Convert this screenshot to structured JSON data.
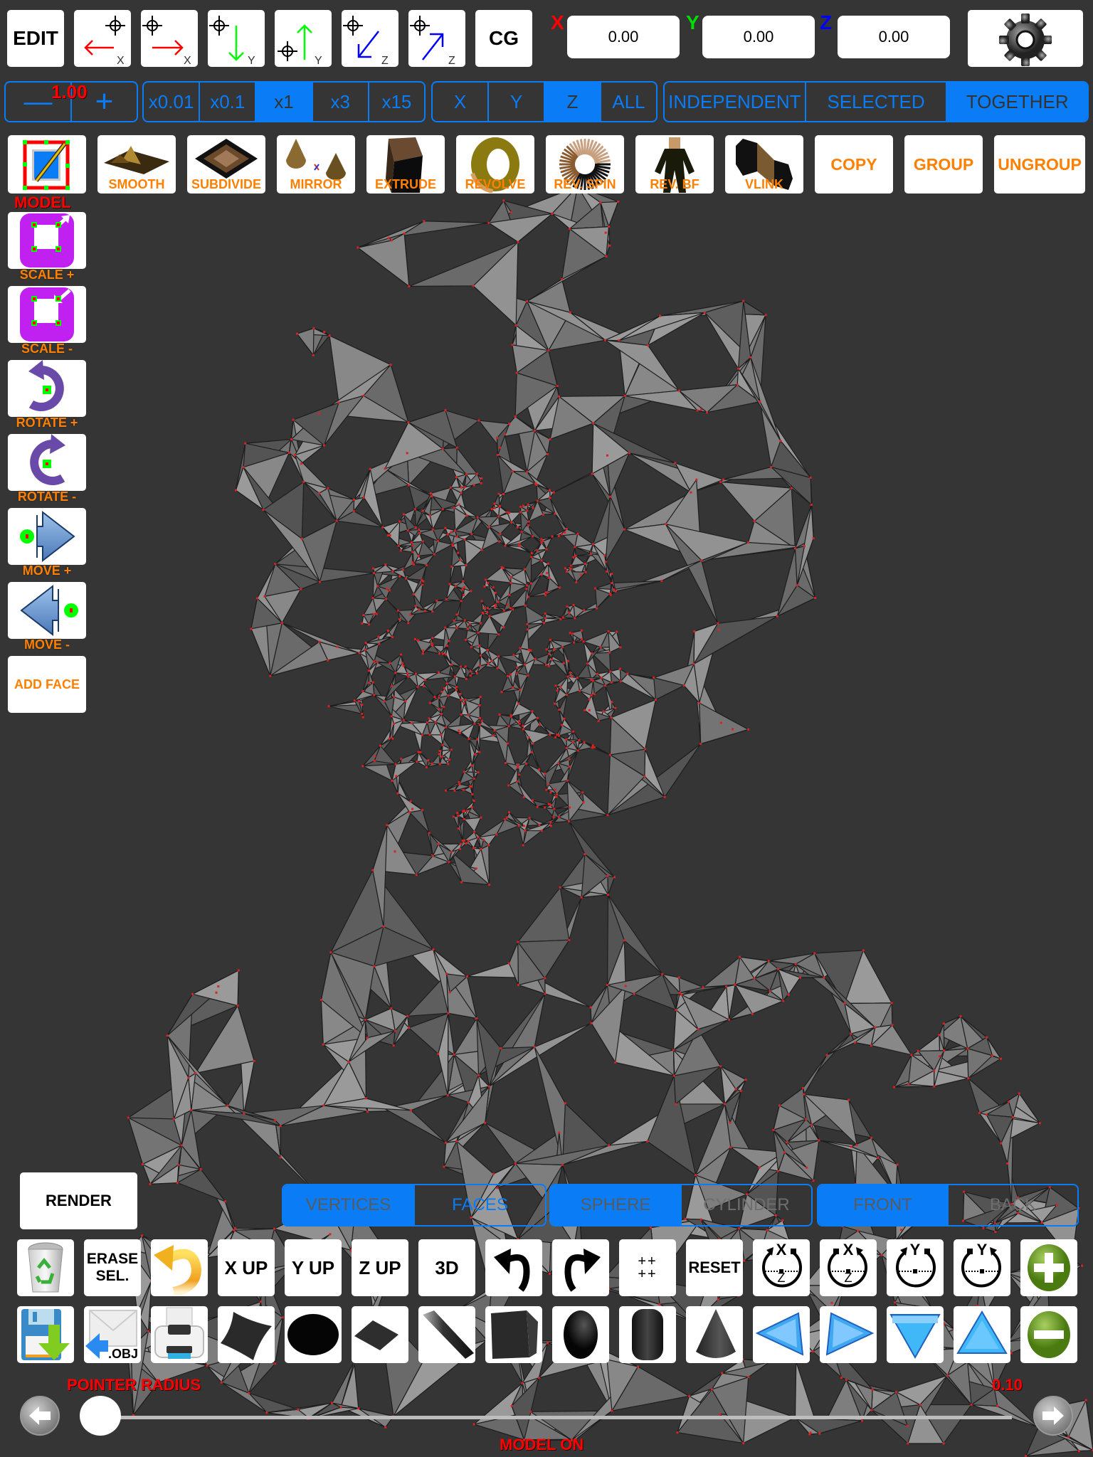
{
  "top_toolbar": {
    "edit_label": "EDIT",
    "move_buttons": [
      {
        "name": "move-left-x",
        "axis": "X",
        "dir": "left",
        "color": "#ff0000"
      },
      {
        "name": "move-right-x",
        "axis": "X",
        "dir": "right",
        "color": "#ff0000"
      },
      {
        "name": "move-down-y",
        "axis": "Y",
        "dir": "down",
        "color": "#00ff00"
      },
      {
        "name": "move-up-y",
        "axis": "Y",
        "dir": "up",
        "color": "#00ff00"
      },
      {
        "name": "move-in-z",
        "axis": "Z",
        "dir": "downleft",
        "color": "#0000ff"
      },
      {
        "name": "move-out-z",
        "axis": "Z",
        "dir": "upright",
        "color": "#0000ff"
      }
    ],
    "cg_label": "CG",
    "coords": [
      {
        "label": "X",
        "value": "0.00",
        "color": "#ff0000"
      },
      {
        "label": "Y",
        "value": "0.00",
        "color": "#00dd00"
      },
      {
        "label": "Z",
        "value": "0.00",
        "color": "#0000ff"
      }
    ],
    "settings_icon": "gear-icon"
  },
  "step_control": {
    "minus": "—",
    "plus": "+",
    "value": "1.00"
  },
  "multiplier": {
    "options": [
      "x0.01",
      "x0.1",
      "x1",
      "x3",
      "x15"
    ],
    "selected": "x1"
  },
  "axis_select": {
    "options": [
      "X",
      "Y",
      "Z",
      "ALL"
    ],
    "selected": "Z"
  },
  "mode_select": {
    "options": [
      "INDEPENDENT",
      "SELECTED",
      "TOGETHER"
    ],
    "selected": "TOGETHER"
  },
  "tools": {
    "model_caption": "MODEL",
    "items": [
      {
        "label": "SMOOTH"
      },
      {
        "label": "SUBDIVIDE"
      },
      {
        "label": "MIRROR"
      },
      {
        "label": "EXTRUDE"
      },
      {
        "label": "REVOLVE"
      },
      {
        "label": "REV. SPIN"
      },
      {
        "label": "REV. BF"
      },
      {
        "label": "VLINK"
      }
    ],
    "text_buttons": [
      "COPY",
      "GROUP",
      "UNGROUP"
    ]
  },
  "side_tools": [
    {
      "label": "SCALE +"
    },
    {
      "label": "SCALE -"
    },
    {
      "label": "ROTATE +"
    },
    {
      "label": "ROTATE -"
    },
    {
      "label": "MOVE +"
    },
    {
      "label": "MOVE -"
    }
  ],
  "add_face_label": "ADD FACE",
  "render_label": "RENDER",
  "selection_mode": {
    "options": [
      "VERTICES",
      "FACES"
    ],
    "selected": "VERTICES"
  },
  "shape_mode": {
    "options": [
      "SPHERE",
      "CYLINDER"
    ],
    "selected": "SPHERE"
  },
  "side_mode": {
    "options": [
      "FRONT",
      "BACK"
    ],
    "selected": "FRONT"
  },
  "bottom_row1": {
    "erase_sel": [
      "ERASE",
      "SEL."
    ],
    "x_up": "X UP",
    "y_up": "Y UP",
    "z_up": "Z UP",
    "three_d": "3D",
    "grid": [
      "++",
      "++"
    ],
    "reset": "RESET",
    "rot_labels": [
      {
        "top": "X",
        "bottom": "Z"
      },
      {
        "top": "X",
        "bottom": "Z"
      },
      {
        "top": "Y",
        "bottom": ""
      },
      {
        "top": "Y",
        "bottom": ""
      }
    ]
  },
  "bottom_row2": {
    "obj_label": ".OBJ"
  },
  "pointer_radius": {
    "label": "POINTER RADIUS",
    "value": "0.10",
    "fraction": 0.0
  },
  "status": "MODEL ON"
}
